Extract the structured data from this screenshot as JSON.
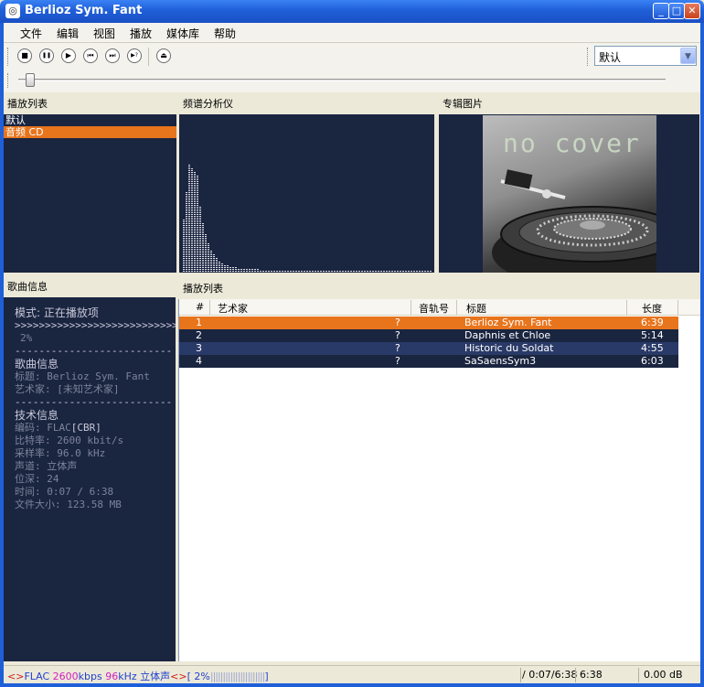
{
  "window": {
    "title": "Berlioz Sym. Fant"
  },
  "menu": [
    "文件",
    "编辑",
    "视图",
    "播放",
    "媒体库",
    "帮助"
  ],
  "toolbar": {
    "buttons": [
      {
        "name": "stop-button",
        "glyph": "■"
      },
      {
        "name": "pause-button",
        "glyph": "❚❚"
      },
      {
        "name": "play-button",
        "glyph": "▶"
      },
      {
        "name": "previous-button",
        "glyph": "⏮"
      },
      {
        "name": "next-button",
        "glyph": "⏭"
      },
      {
        "name": "random-button",
        "glyph": "▶?"
      },
      {
        "name": "open-button",
        "glyph": "⏏"
      }
    ],
    "preset_value": "默认"
  },
  "seek": {
    "progress": 0.02
  },
  "panels": {
    "playlists_title": "播放列表",
    "spectrum_title": "频谱分析仪",
    "albumart_title": "专辑图片",
    "info_title": "歌曲信息",
    "tracks_title": "播放列表"
  },
  "playlists": [
    {
      "label": "默认",
      "selected": false
    },
    {
      "label": "音频 CD",
      "selected": true
    }
  ],
  "albumart": {
    "text": "no cover"
  },
  "info": {
    "mode": "模式: 正在播放项",
    "progress_bar": ">>>>>>>>>>>>>>>>>>>>>>>>>>>>",
    "progress_pct": "2%",
    "divider": "--------------------------",
    "song_header": "歌曲信息",
    "title_line": "标题: Berlioz Sym. Fant",
    "artist_line": "艺术家: [未知艺术家]",
    "tech_header": "技术信息",
    "codec_label": "编码: ",
    "codec_value": "FLAC",
    "codec_extra": "[CBR]",
    "bitrate": "比特率: 2600 kbit/s",
    "samplerate": "采样率: 96.0 kHz",
    "channels": "声道: 立体声",
    "bitdepth": "位深: 24",
    "time": "时间: 0:07 / 6:38",
    "filesize": "文件大小: 123.58 MB"
  },
  "tracks": {
    "columns": [
      "#",
      "艺术家",
      "音轨号",
      "标题",
      "长度"
    ],
    "rows": [
      {
        "num": "1",
        "artist": "?",
        "track": "",
        "title": "Berlioz Sym. Fant",
        "length": "6:39",
        "playing": true
      },
      {
        "num": "2",
        "artist": "?",
        "track": "",
        "title": "Daphnis et Chloe",
        "length": "5:14",
        "playing": false
      },
      {
        "num": "3",
        "artist": "?",
        "track": "",
        "title": "Historic du Soldat",
        "length": "4:55",
        "playing": false
      },
      {
        "num": "4",
        "artist": "?",
        "track": "",
        "title": "SaSaensSym3",
        "length": "6:03",
        "playing": false
      }
    ]
  },
  "status": {
    "codec": "FLAC",
    "bitrate": "2600",
    "bitrate_unit": "kbps",
    "samplerate": "96",
    "samplerate_unit": "kHz",
    "channels": "立体声",
    "pct": "2%",
    "position": "/ 0:07/6:38",
    "length": "6:38",
    "volume": "0.00 dB"
  },
  "colors": {
    "panel_bg": "#1A2540",
    "highlight": "#E8741C",
    "row_alt": "#2A3A68",
    "status_magenta": "#D020C0",
    "status_blue": "#2040D0"
  }
}
